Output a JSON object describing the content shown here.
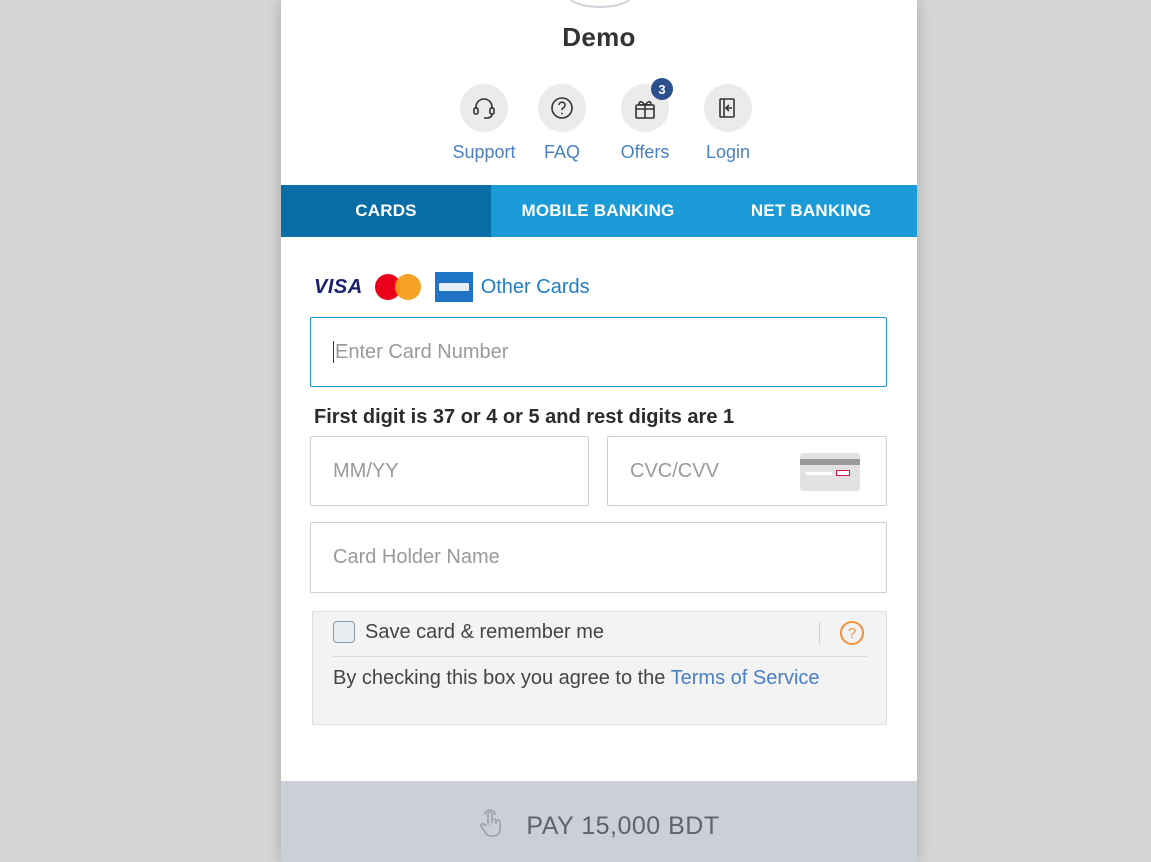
{
  "merchant": {
    "name": "Demo"
  },
  "quick_links": [
    {
      "label": "Support",
      "icon": "headset-icon"
    },
    {
      "label": "FAQ",
      "icon": "question-icon"
    },
    {
      "label": "Offers",
      "icon": "gift-icon",
      "badge": "3"
    },
    {
      "label": "Login",
      "icon": "login-icon"
    }
  ],
  "tabs": [
    {
      "label": "CARDS",
      "active": true
    },
    {
      "label": "MOBILE BANKING",
      "active": false
    },
    {
      "label": "NET BANKING",
      "active": false
    }
  ],
  "card_brands": {
    "visa": "VISA",
    "other_cards": "Other Cards"
  },
  "form": {
    "card_number_placeholder": "Enter Card Number",
    "hint": "First digit is 37 or 4 or 5 and rest digits are 1",
    "expiry_placeholder": "MM/YY",
    "cvv_placeholder": "CVC/CVV",
    "holder_placeholder": "Card Holder Name"
  },
  "save_card": {
    "label": "Save card & remember me",
    "help": "?",
    "terms_prefix": "By checking this box you agree to the ",
    "terms_link": "Terms of Service"
  },
  "pay_button": {
    "label": "PAY 15,000 BDT"
  },
  "colors": {
    "tab_bar": "#1a9bd7",
    "tab_active": "#0a6ea6",
    "link": "#4a7fc1",
    "pay_bg": "#ccd0d6",
    "help_accent": "#f0923b"
  }
}
